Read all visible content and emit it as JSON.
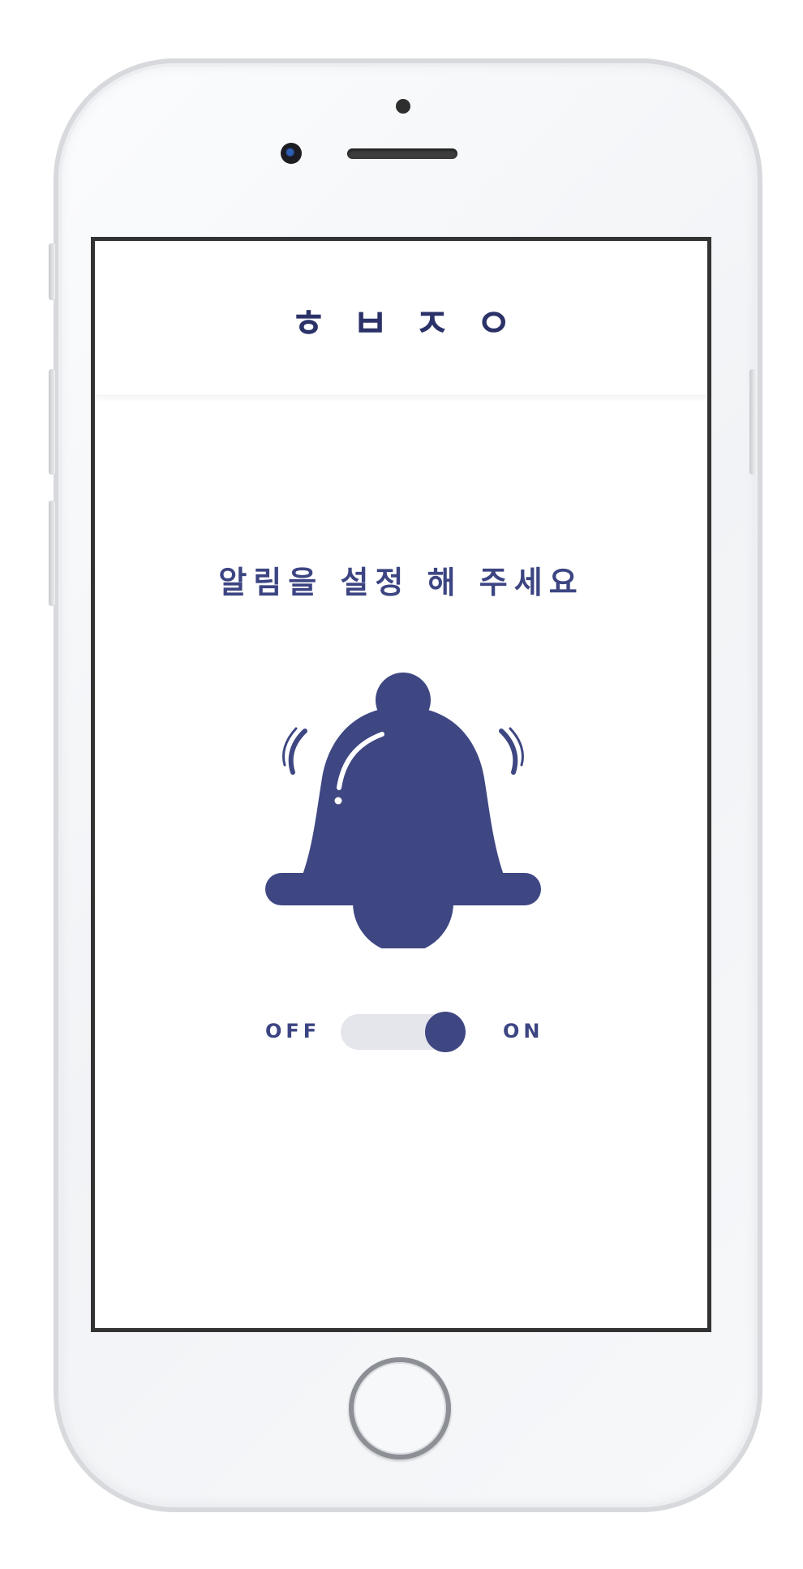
{
  "app": {
    "logo_text": "ㅎㅂㅈㅇ"
  },
  "main": {
    "prompt": "알림을 설정 해 주세요"
  },
  "toggle": {
    "off_label": "OFF",
    "on_label": "ON",
    "state": "on",
    "position": 1
  },
  "icons": {
    "bell": "bell-ringing-icon"
  },
  "colors": {
    "accent": "#3e4782",
    "logo": "#2b3268",
    "track": "#e5e6ec",
    "screen_border": "#333333"
  }
}
